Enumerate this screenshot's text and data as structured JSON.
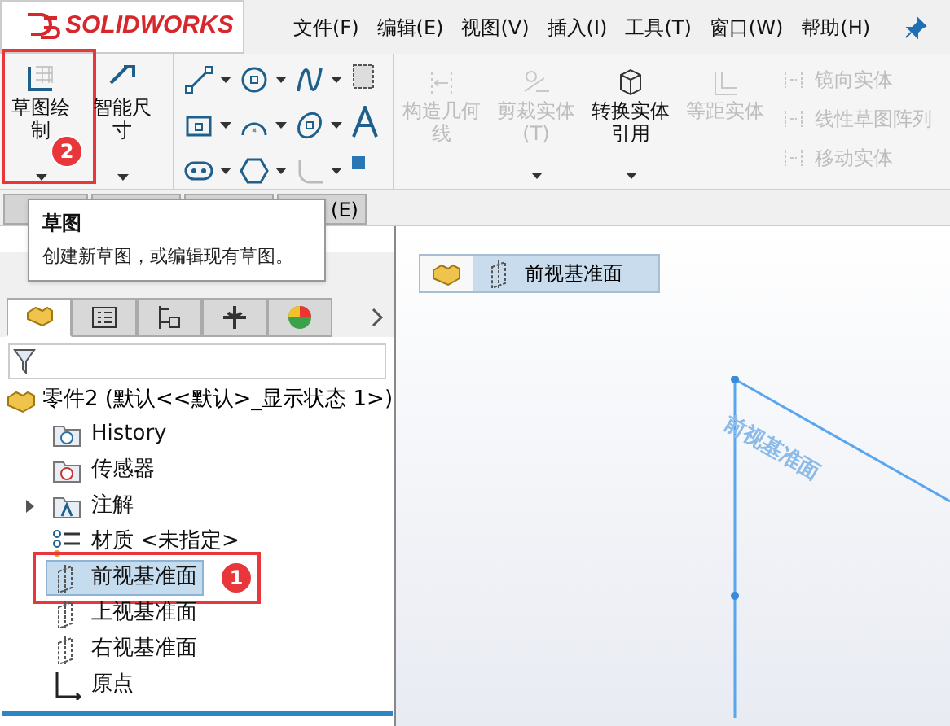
{
  "app": {
    "logo": "SOLIDWORKS"
  },
  "menu": [
    {
      "label": "文件(F)"
    },
    {
      "label": "编辑(E)"
    },
    {
      "label": "视图(V)"
    },
    {
      "label": "插入(I)"
    },
    {
      "label": "工具(T)"
    },
    {
      "label": "窗口(W)"
    },
    {
      "label": "帮助(H)"
    }
  ],
  "ribbon": {
    "large": [
      {
        "label": "草图绘制",
        "kind": "sketch",
        "disabled": false
      },
      {
        "label": "智能尺寸",
        "kind": "dimension",
        "disabled": false
      }
    ],
    "tools": [
      {
        "kind": "line"
      },
      {
        "kind": "circle"
      },
      {
        "kind": "spline"
      },
      {
        "kind": "rect"
      },
      {
        "kind": "arc"
      },
      {
        "kind": "ellipse"
      },
      {
        "kind": "slot"
      },
      {
        "kind": "polygon"
      },
      {
        "kind": "fillet"
      }
    ],
    "commands": [
      {
        "label": "构造几何线",
        "kind": "construct",
        "disabled": true
      },
      {
        "label": "剪裁实体(T)",
        "kind": "trim",
        "disabled": true
      },
      {
        "label": "转换实体引用",
        "kind": "convert",
        "disabled": false
      },
      {
        "label": "等距实体",
        "kind": "offset",
        "disabled": true
      }
    ],
    "small": [
      {
        "label": "镜向实体",
        "disabled": true
      },
      {
        "label": "线性草图阵列",
        "disabled": true
      },
      {
        "label": "移动实体",
        "disabled": true
      }
    ]
  },
  "command_tabs": [
    {
      "label": "(E)"
    }
  ],
  "tooltip": {
    "title": "草图",
    "text": "创建新草图，或编辑现有草图。"
  },
  "panel_tabs": [
    {
      "kind": "tree",
      "selected": true
    },
    {
      "kind": "property",
      "selected": false
    },
    {
      "kind": "config",
      "selected": false
    },
    {
      "kind": "dimxpert",
      "selected": false
    },
    {
      "kind": "display",
      "selected": false
    }
  ],
  "tree": {
    "label": "零件2 (默认<<默认>_显示状态 1>)",
    "children": [
      {
        "label": "History",
        "kind": "history",
        "selected": false
      },
      {
        "label": "传感器",
        "kind": "sensor",
        "selected": false
      },
      {
        "label": "注解",
        "kind": "annotation",
        "selected": false,
        "expanded": false
      },
      {
        "label": "材质 <未指定>",
        "kind": "material",
        "selected": false
      },
      {
        "label": "前视基准面",
        "kind": "plane",
        "selected": true
      },
      {
        "label": "上视基准面",
        "kind": "plane",
        "selected": false
      },
      {
        "label": "右视基准面",
        "kind": "plane",
        "selected": false
      },
      {
        "label": "原点",
        "kind": "origin",
        "selected": false
      }
    ]
  },
  "breadcrumb": {
    "label": "前视基准面"
  },
  "viewport": {
    "plane_label": "前视基准面"
  },
  "annotations": [
    {
      "number": "2"
    },
    {
      "number": "1"
    }
  ]
}
